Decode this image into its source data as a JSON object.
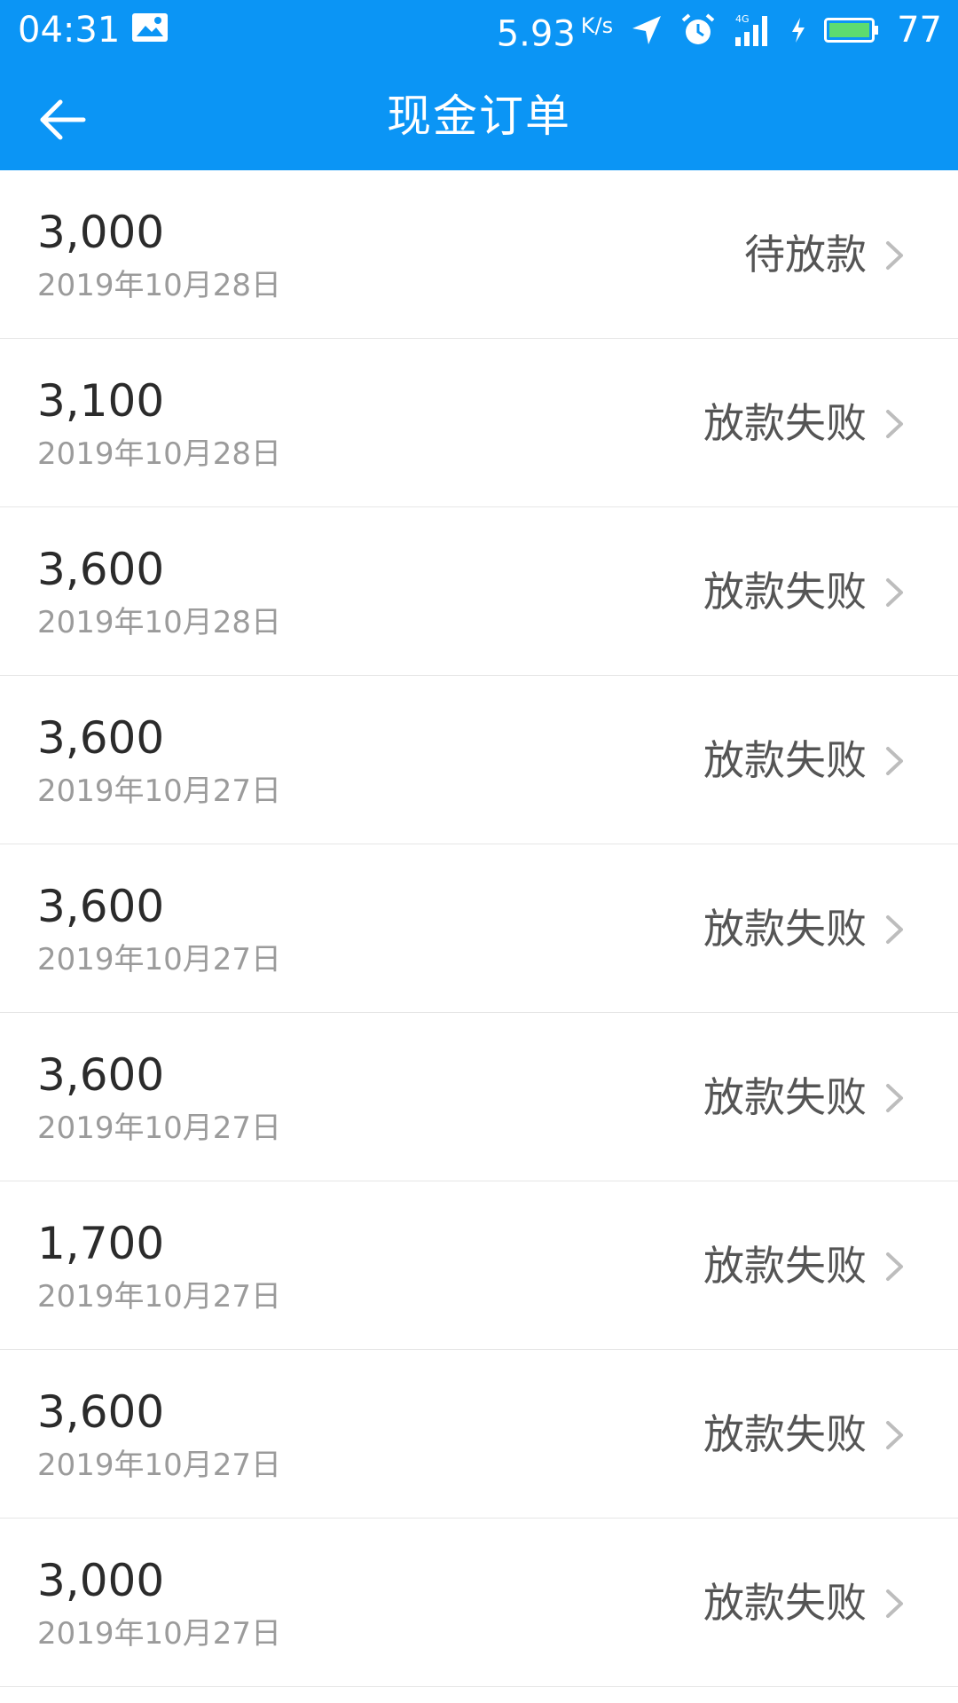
{
  "status_bar": {
    "time": "04:31",
    "net_speed": "5.93",
    "net_speed_unit": "K/s",
    "battery_percent": "77",
    "network_type": "4G",
    "icons": [
      "image-notification-icon",
      "location-arrow-icon",
      "alarm-icon",
      "signal-icon",
      "charging-icon",
      "battery-icon"
    ]
  },
  "header": {
    "title": "现金订单",
    "back_icon": "back-arrow-icon",
    "background_color": "#0b95f5"
  },
  "orders": [
    {
      "amount": "3,000",
      "date": "2019年10月28日",
      "status": "待放款"
    },
    {
      "amount": "3,100",
      "date": "2019年10月28日",
      "status": "放款失败"
    },
    {
      "amount": "3,600",
      "date": "2019年10月28日",
      "status": "放款失败"
    },
    {
      "amount": "3,600",
      "date": "2019年10月27日",
      "status": "放款失败"
    },
    {
      "amount": "3,600",
      "date": "2019年10月27日",
      "status": "放款失败"
    },
    {
      "amount": "3,600",
      "date": "2019年10月27日",
      "status": "放款失败"
    },
    {
      "amount": "1,700",
      "date": "2019年10月27日",
      "status": "放款失败"
    },
    {
      "amount": "3,600",
      "date": "2019年10月27日",
      "status": "放款失败"
    },
    {
      "amount": "3,000",
      "date": "2019年10月27日",
      "status": "放款失败"
    }
  ]
}
